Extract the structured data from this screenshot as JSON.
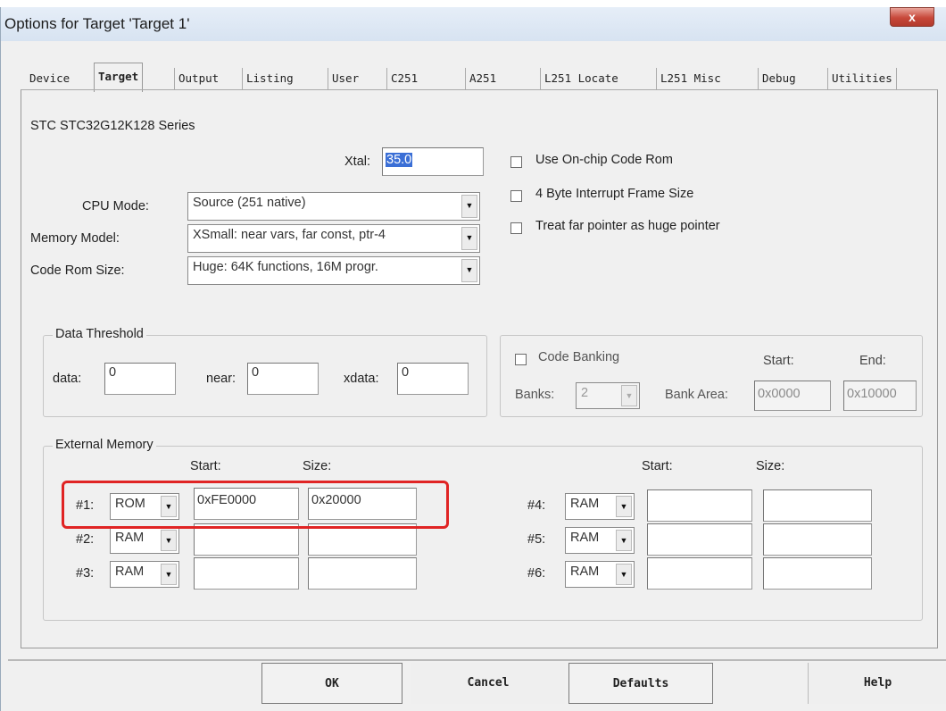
{
  "window": {
    "title": "Options for Target 'Target 1'",
    "close_label": "x"
  },
  "tabs": [
    "Device",
    "Target",
    "Output",
    "Listing",
    "User",
    "C251",
    "A251",
    "L251 Locate",
    "L251 Misc",
    "Debug",
    "Utilities"
  ],
  "active_tab": "Target",
  "device_name": "STC STC32G12K128 Series",
  "xtal": {
    "label": "Xtal:",
    "value": "35.0"
  },
  "cpu_mode": {
    "label": "CPU Mode:",
    "value": "Source (251 native)"
  },
  "memory_model": {
    "label": "Memory Model:",
    "value": "XSmall: near vars, far const, ptr-4"
  },
  "code_rom_size": {
    "label": "Code Rom Size:",
    "value": "Huge: 64K functions, 16M progr."
  },
  "options": {
    "onchip_rom": "Use On-chip Code Rom",
    "interrupt_frame": "4 Byte Interrupt Frame Size",
    "far_pointer": "Treat far pointer as huge pointer"
  },
  "data_threshold": {
    "title": "Data Threshold",
    "data_label": "data:",
    "data_value": "0",
    "near_label": "near:",
    "near_value": "0",
    "xdata_label": "xdata:",
    "xdata_value": "0"
  },
  "code_banking": {
    "label": "Code Banking",
    "start_label": "Start:",
    "end_label": "End:",
    "banks_label": "Banks:",
    "banks_value": "2",
    "bank_area_label": "Bank Area:",
    "start_value": "0x0000",
    "end_value": "0x10000"
  },
  "external_memory": {
    "title": "External Memory",
    "start_header": "Start:",
    "size_header": "Size:",
    "rows": [
      {
        "label": "#1:",
        "type": "ROM",
        "start": "0xFE0000",
        "size": "0x20000"
      },
      {
        "label": "#2:",
        "type": "RAM",
        "start": "",
        "size": ""
      },
      {
        "label": "#3:",
        "type": "RAM",
        "start": "",
        "size": ""
      },
      {
        "label": "#4:",
        "type": "RAM",
        "start": "",
        "size": ""
      },
      {
        "label": "#5:",
        "type": "RAM",
        "start": "",
        "size": ""
      },
      {
        "label": "#6:",
        "type": "RAM",
        "start": "",
        "size": ""
      }
    ]
  },
  "buttons": {
    "ok": "OK",
    "cancel": "Cancel",
    "defaults": "Defaults",
    "help": "Help"
  },
  "colors": {
    "highlight": "#e02424",
    "selection": "#3b6fd6"
  }
}
